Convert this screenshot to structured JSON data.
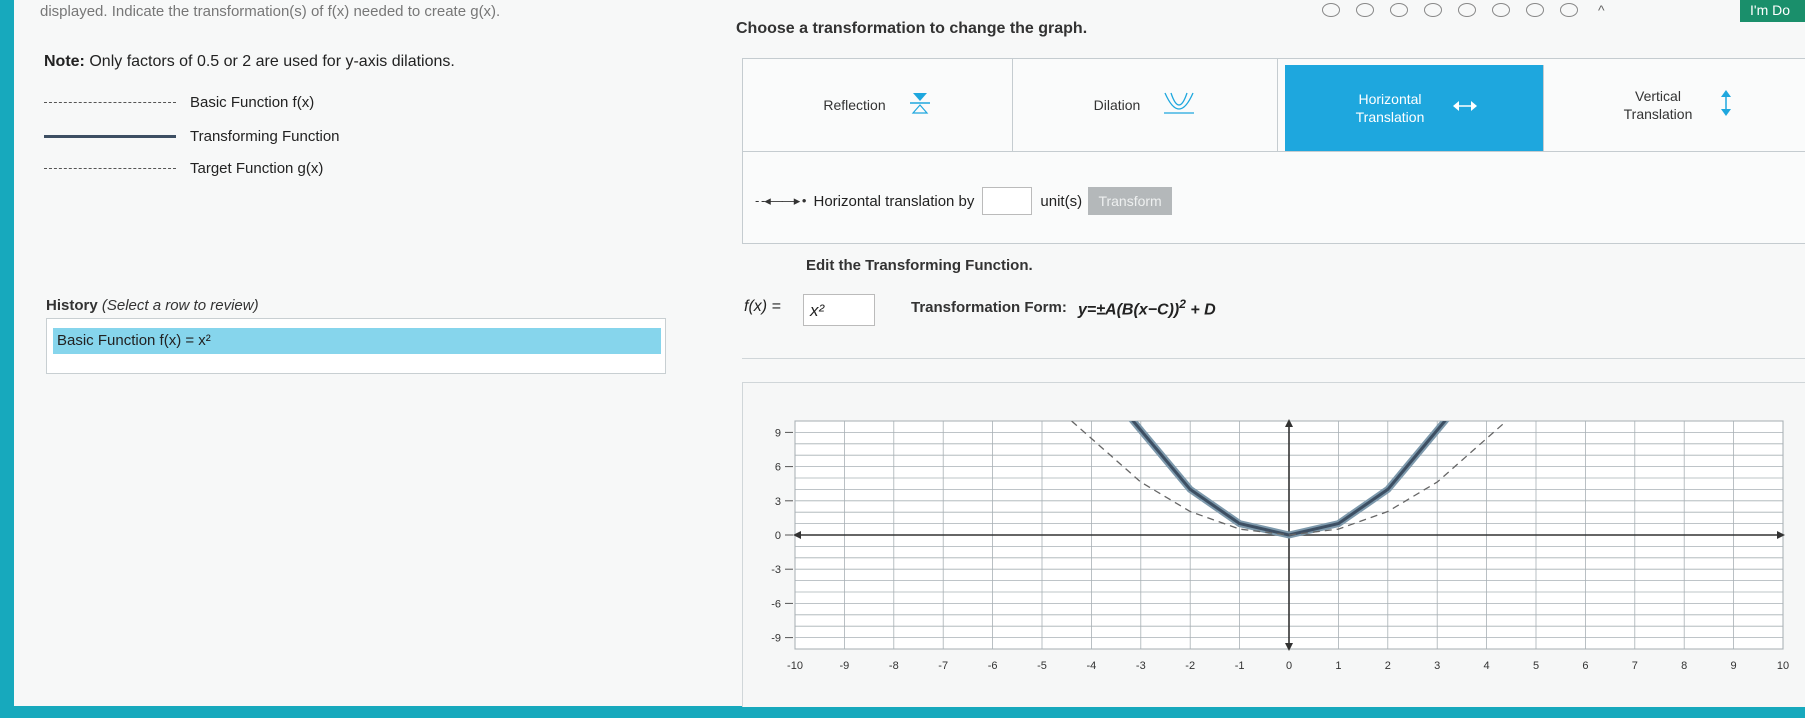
{
  "top": {
    "instruction_fragment": "displayed. Indicate the transformation(s) of f(x) needed to create g(x).",
    "prompt": "Choose a transformation to change the graph.",
    "step_count": 8,
    "done_label": "I'm Do"
  },
  "note": {
    "label": "Note:",
    "text": "Only factors of 0.5 or 2 are used for y-axis dilations."
  },
  "legend": [
    {
      "label": "Basic Function f(x)",
      "style": "dashed"
    },
    {
      "label": "Transforming Function",
      "style": "solid"
    },
    {
      "label": "Target Function g(x)",
      "style": "dashed"
    }
  ],
  "tabs": [
    {
      "label": "Reflection",
      "icon": "reflection-icon"
    },
    {
      "label": "Dilation",
      "icon": "dilation-icon"
    },
    {
      "label": "Horizontal Translation",
      "icon": "horizontal-arrows-icon",
      "active": true
    },
    {
      "label": "Vertical Translation",
      "icon": "vertical-arrows-icon"
    }
  ],
  "translation": {
    "text": "Horizontal translation by",
    "unit": "unit(s)",
    "value": "",
    "button": "Transform"
  },
  "edit": {
    "title": "Edit the Transforming Function.",
    "fx_label": "f(x) =",
    "fx_value": "x²",
    "form_label": "Transformation Form:",
    "form_expr": "y=±A(B(x−C))",
    "form_exp": "2",
    "form_tail": "+ D"
  },
  "history": {
    "title": "History",
    "hint": "(Select a row to review)",
    "rows": [
      {
        "label": "Basic Function f(x) = x²"
      }
    ]
  },
  "colors": {
    "accent": "#1ea7de",
    "highlight": "#86d5ec",
    "frame": "#17a9bd",
    "curve": "#3d4f63",
    "curve_outline": "#7d99ac"
  },
  "chart_data": {
    "type": "line",
    "x_ticks": [
      -10,
      -9,
      -8,
      -7,
      -6,
      -5,
      -4,
      -3,
      -2,
      -1,
      0,
      1,
      2,
      3,
      4,
      5,
      6,
      7,
      8,
      9,
      10
    ],
    "y_ticks": [
      9,
      6,
      3,
      0,
      -3,
      -6,
      -9
    ],
    "xlim": [
      -10,
      10
    ],
    "ylim": [
      -10,
      10
    ],
    "grid": true,
    "series": [
      {
        "style": "solid",
        "x": [
          -3.2,
          -2,
          -1,
          0,
          1,
          2,
          3.2
        ],
        "y": [
          10.24,
          4,
          1,
          0,
          1,
          4,
          10.24
        ]
      },
      {
        "style": "dashed",
        "x": [
          -4.4,
          -3,
          -2,
          -1,
          0,
          1,
          2,
          3,
          4.4
        ],
        "y": [
          10,
          4.64,
          2.06,
          0.52,
          0,
          0.52,
          2.06,
          4.64,
          10
        ]
      }
    ]
  }
}
